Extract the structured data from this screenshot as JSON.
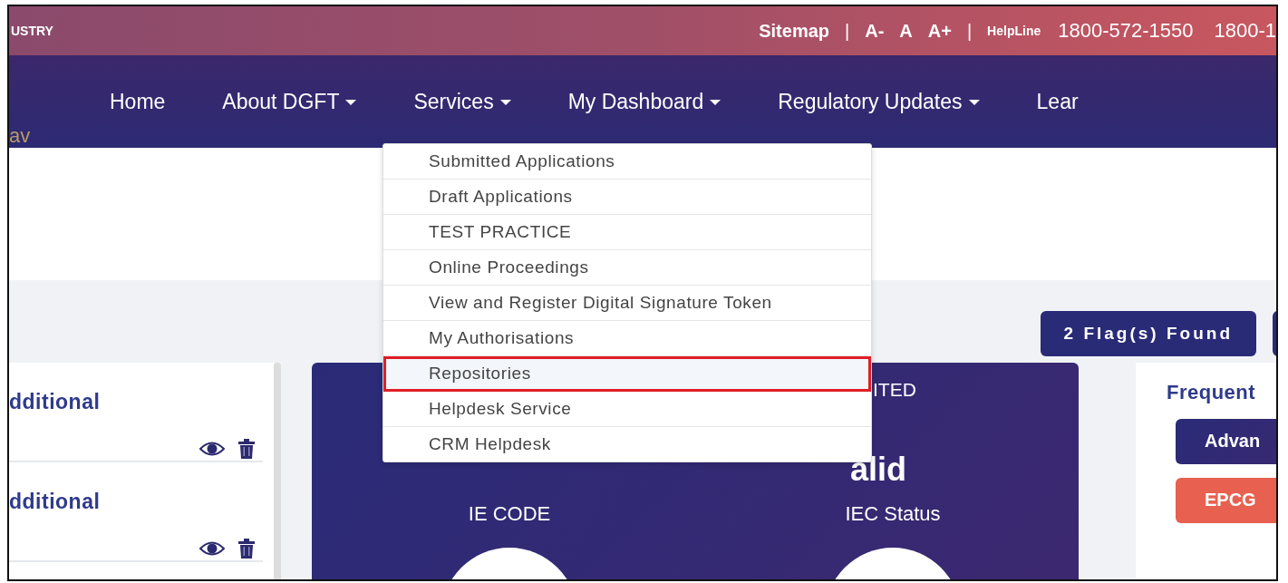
{
  "top_bar": {
    "brand": "USTRY",
    "items": [
      {
        "kind": "link",
        "text": "Sitemap"
      },
      {
        "kind": "sep",
        "text": "|"
      },
      {
        "kind": "link",
        "text": "A-"
      },
      {
        "kind": "link",
        "text": "A"
      },
      {
        "kind": "link",
        "text": "A+"
      },
      {
        "kind": "sep",
        "text": "|"
      },
      {
        "kind": "label",
        "text": "HelpLine"
      },
      {
        "kind": "phone",
        "text": "1800-572-1550"
      },
      {
        "kind": "phone",
        "text": "1800-1"
      }
    ]
  },
  "nav": {
    "items": [
      {
        "label": "Home",
        "dropdown": false
      },
      {
        "label": "About DGFT",
        "dropdown": true
      },
      {
        "label": "Services",
        "dropdown": true
      },
      {
        "label": "My Dashboard",
        "dropdown": true
      },
      {
        "label": "Regulatory Updates",
        "dropdown": true
      },
      {
        "label": "Lear",
        "dropdown": false
      }
    ],
    "user_fragment": "av"
  },
  "menu": {
    "items": [
      {
        "label": "Submitted Applications",
        "highlighted": false
      },
      {
        "label": "Draft Applications",
        "highlighted": false
      },
      {
        "label": "TEST PRACTICE",
        "highlighted": false
      },
      {
        "label": "Online Proceedings",
        "highlighted": false
      },
      {
        "label": "View and Register Digital Signature Token",
        "highlighted": false
      },
      {
        "label": "My Authorisations",
        "highlighted": false
      },
      {
        "label": "Repositories",
        "highlighted": true
      },
      {
        "label": "Helpdesk Service",
        "highlighted": false
      },
      {
        "label": "CRM Helpdesk",
        "highlighted": false
      }
    ]
  },
  "flags_button": "2 Flag(s) Found",
  "applications": [
    {
      "title": "dditional"
    },
    {
      "title": "dditional"
    }
  ],
  "iec_card": {
    "name_fragment": "ITED",
    "code_label": "IE CODE",
    "status": "alid",
    "status_label": "IEC Status"
  },
  "frequent": {
    "title": "Frequent",
    "buttons": [
      {
        "label": "Advan",
        "kind": "primary"
      },
      {
        "label": "EPCG",
        "kind": "accent"
      }
    ]
  }
}
